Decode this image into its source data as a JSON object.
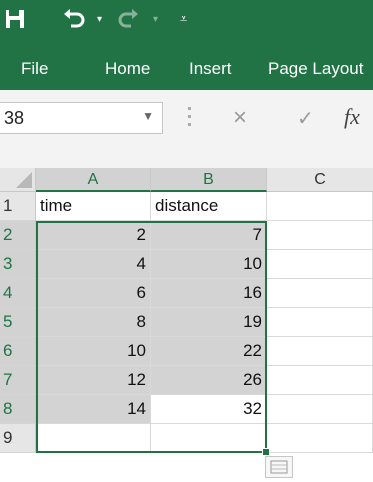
{
  "quick_access": {
    "save_icon": "save-icon",
    "undo_icon": "undo-icon",
    "redo_icon": "redo-icon",
    "customize_icon": "customize-icon"
  },
  "ribbon": {
    "tabs": [
      {
        "label": "File"
      },
      {
        "label": "Home"
      },
      {
        "label": "Insert"
      },
      {
        "label": "Page Layout"
      }
    ]
  },
  "formula_bar": {
    "name_box": "38",
    "cancel_icon": "×",
    "enter_icon": "✓",
    "fx_label": "fx",
    "formula": ""
  },
  "sheet": {
    "columns": [
      "A",
      "B",
      "C"
    ],
    "rows": [
      "1",
      "2",
      "3",
      "4",
      "5",
      "6",
      "7",
      "8",
      "9"
    ],
    "headers": {
      "a": "time",
      "b": "distance"
    },
    "data": [
      {
        "time": "2",
        "distance": "7"
      },
      {
        "time": "4",
        "distance": "10"
      },
      {
        "time": "6",
        "distance": "16"
      },
      {
        "time": "8",
        "distance": "19"
      },
      {
        "time": "10",
        "distance": "22"
      },
      {
        "time": "12",
        "distance": "26"
      },
      {
        "time": "14",
        "distance": "32"
      }
    ]
  },
  "colors": {
    "accent": "#217346",
    "selection_fill": "#d3d3d3"
  }
}
